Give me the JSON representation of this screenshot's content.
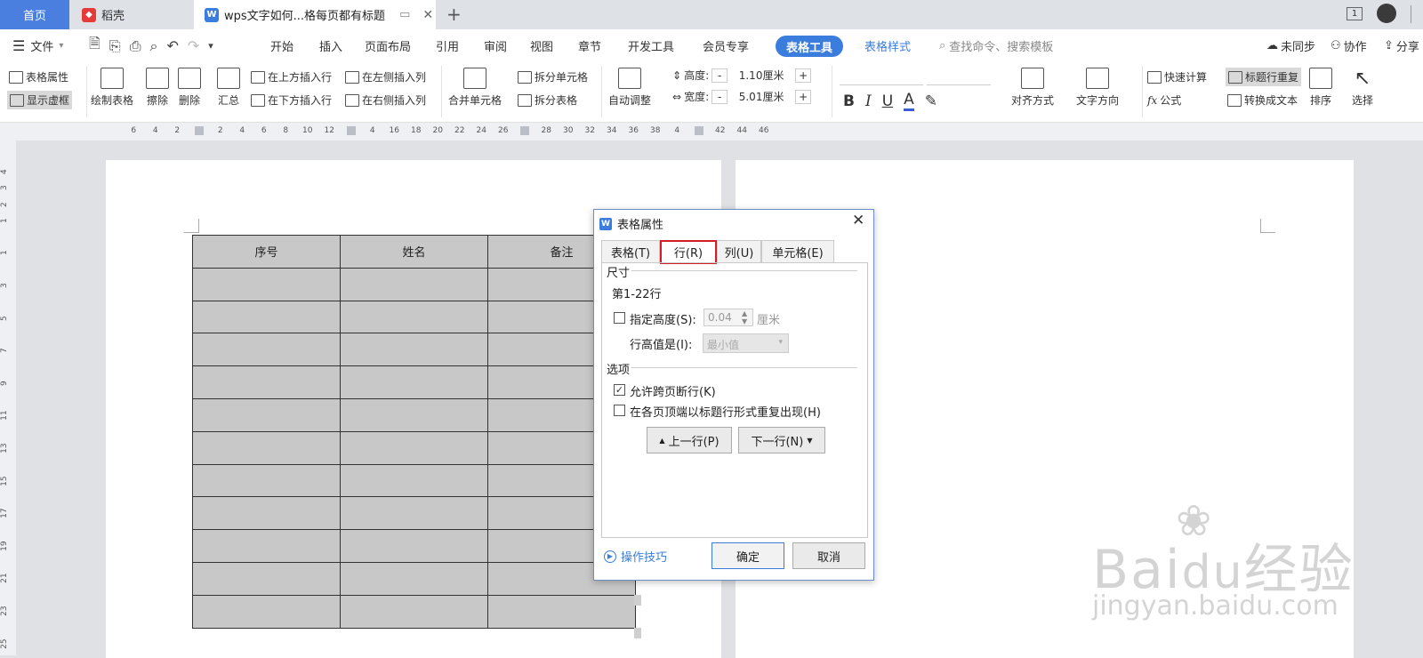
{
  "tabs": {
    "home": "首页",
    "docer": "稻壳",
    "active_doc": "wps文字如何...格每页都有标题",
    "new_tab": "+",
    "page_indicator": "1"
  },
  "menubar": {
    "file": "文件",
    "items": [
      "开始",
      "插入",
      "页面布局",
      "引用",
      "审阅",
      "视图",
      "章节",
      "开发工具",
      "会员专享"
    ],
    "active": "表格工具",
    "table_style": "表格样式",
    "search": "查找命令、搜索模板",
    "sync": "未同步",
    "collab": "协作",
    "share": "分享"
  },
  "ribbon": {
    "table_props": "表格属性",
    "show_gridlines": "显示虚框",
    "draw_table": "绘制表格",
    "erase": "擦除",
    "delete": "删除",
    "summary": "汇总",
    "insert_above": "在上方插入行",
    "insert_below": "在下方插入行",
    "insert_left": "在左侧插入列",
    "insert_right": "在右侧插入列",
    "merge_cells": "合并单元格",
    "split_cells": "拆分单元格",
    "split_table": "拆分表格",
    "auto_fit": "自动调整",
    "height_label": "高度:",
    "height_value": "1.10厘米",
    "width_label": "宽度:",
    "width_value": "5.01厘米",
    "bold": "B",
    "italic": "I",
    "underline": "U",
    "font_color": "A",
    "align": "对齐方式",
    "text_dir": "文字方向",
    "quick_calc": "快速计算",
    "formula": "公式",
    "header_repeat": "标题行重复",
    "to_text": "转换成文本",
    "sort": "排序",
    "select": "选择",
    "minus": "-",
    "plus": "+"
  },
  "ruler": {
    "ticks": [
      "6",
      "4",
      "2",
      "",
      "2",
      "4",
      "6",
      "8",
      "10",
      "12",
      "",
      "4",
      "16",
      "18",
      "20",
      "22",
      "24",
      "26",
      "",
      "28",
      "30",
      "32",
      "34",
      "36",
      "38",
      "4",
      "",
      "42",
      "44",
      "46"
    ]
  },
  "vruler": {
    "ticks": [
      "4",
      "3",
      "2",
      "1",
      "",
      "1",
      "",
      "3",
      "",
      "5",
      "",
      "7",
      "",
      "9",
      "",
      "11",
      "",
      "13",
      "",
      "15",
      "",
      "17",
      "",
      "19",
      "",
      "21",
      "",
      "23",
      "",
      "25"
    ]
  },
  "table": {
    "headers": [
      "序号",
      "姓名",
      "备注"
    ],
    "rows": 11
  },
  "dialog": {
    "title": "表格属性",
    "tabs": [
      "表格(T)",
      "行(R)",
      "列(U)",
      "单元格(E)"
    ],
    "size_section": "尺寸",
    "rows_label": "第1-22行",
    "specify_height": "指定高度(S):",
    "height_value": "0.04",
    "height_unit": "厘米",
    "row_height_is": "行高值是(I):",
    "row_height_mode": "最小值",
    "options_section": "选项",
    "allow_break": "允许跨页断行(K)",
    "repeat_header": "在各页顶端以标题行形式重复出现(H)",
    "prev_row": "上一行(P)",
    "next_row": "下一行(N)",
    "tips": "操作技巧",
    "ok": "确定",
    "cancel": "取消"
  },
  "watermark": {
    "brand": "Bai",
    "suffix": "经验",
    "url": "jingyan.baidu.com"
  },
  "colors": {
    "accent": "#3b7ddd",
    "highlight_border": "#d21f26",
    "table_fill": "#c8c8c8"
  }
}
